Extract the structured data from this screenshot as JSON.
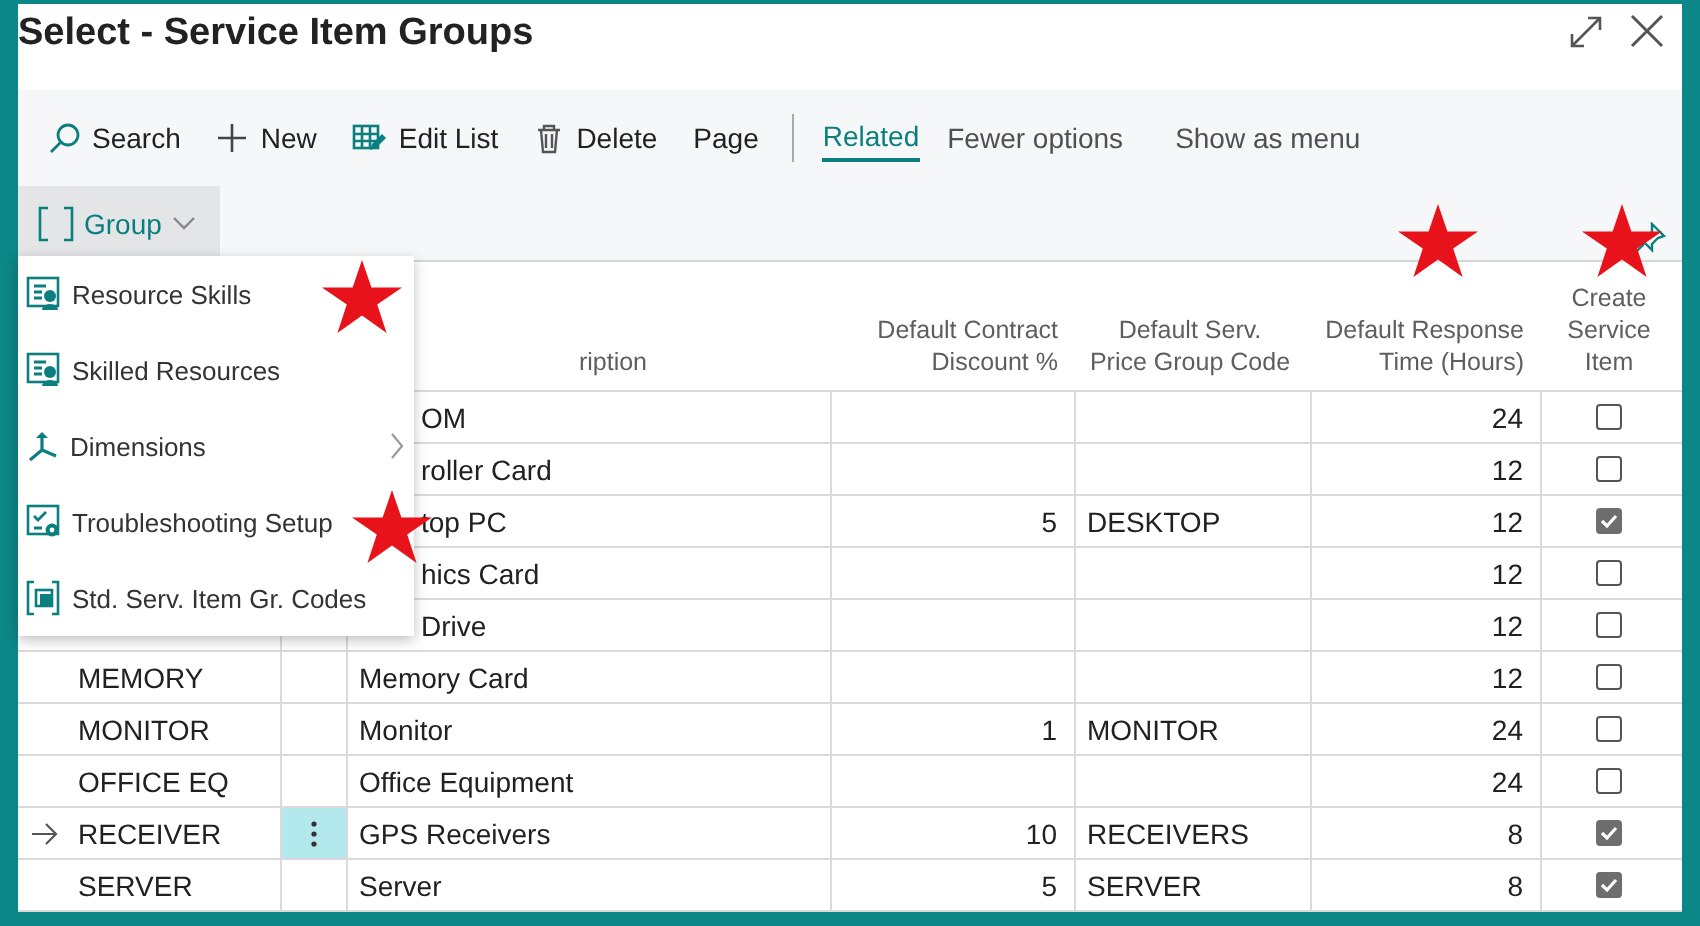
{
  "window": {
    "title": "Select - Service Item Groups"
  },
  "actions": [
    {
      "label": "Search",
      "kind": "search"
    },
    {
      "label": "New",
      "kind": "new"
    },
    {
      "label": "Edit List",
      "kind": "edit"
    },
    {
      "label": "Delete",
      "kind": "delete"
    },
    {
      "label": "Page",
      "kind": "plain"
    }
  ],
  "views": [
    {
      "label": "Related",
      "selected": true
    }
  ],
  "options": [
    "Fewer options",
    "Show as menu"
  ],
  "group_button": {
    "label": "Group",
    "expanded": true
  },
  "menu": [
    {
      "label": "Resource Skills",
      "kind": "skills"
    },
    {
      "label": "Skilled Resources",
      "kind": "skills"
    },
    {
      "label": "Dimensions",
      "kind": "dimensions",
      "submenu": true
    },
    {
      "label": "Troubleshooting Setup",
      "kind": "setup"
    },
    {
      "label": "Std. Serv. Item Gr. Codes",
      "kind": "codes"
    }
  ],
  "table": {
    "columns": [
      {
        "label": "ription"
      },
      {
        "label": "Default Contract\nDiscount %"
      },
      {
        "label": "Default Serv.\nPrice Group Code"
      },
      {
        "label": "Default Response\nTime (Hours)"
      },
      {
        "label": "Create\nService\nItem"
      }
    ],
    "rows": [
      {
        "description": "OM",
        "response": "24",
        "create": false,
        "selected": false
      },
      {
        "description": "roller Card",
        "response": "12",
        "create": false,
        "selected": false
      },
      {
        "description": "top PC",
        "discount": "5",
        "price_group": "DESKTOP",
        "response": "12",
        "create": true,
        "selected": false
      },
      {
        "description": "hics Card",
        "response": "12",
        "create": false,
        "selected": false
      },
      {
        "description": "Drive",
        "response": "12",
        "create": false,
        "selected": false
      },
      {
        "code": "MEMORY",
        "description": "Memory Card",
        "response": "12",
        "create": false,
        "selected": false
      },
      {
        "code": "MONITOR",
        "description": "Monitor",
        "discount": "1",
        "price_group": "MONITOR",
        "response": "24",
        "create": false,
        "selected": false
      },
      {
        "code": "OFFICE EQ",
        "description": "Office Equipment",
        "response": "24",
        "create": false,
        "selected": false
      },
      {
        "code": "RECEIVER",
        "description": "GPS Receivers",
        "discount": "10",
        "price_group": "RECEIVERS",
        "response": "8",
        "create": true,
        "selected": true
      },
      {
        "code": "SERVER",
        "description": "Server",
        "discount": "5",
        "price_group": "SERVER",
        "response": "8",
        "create": true,
        "selected": false
      }
    ]
  }
}
